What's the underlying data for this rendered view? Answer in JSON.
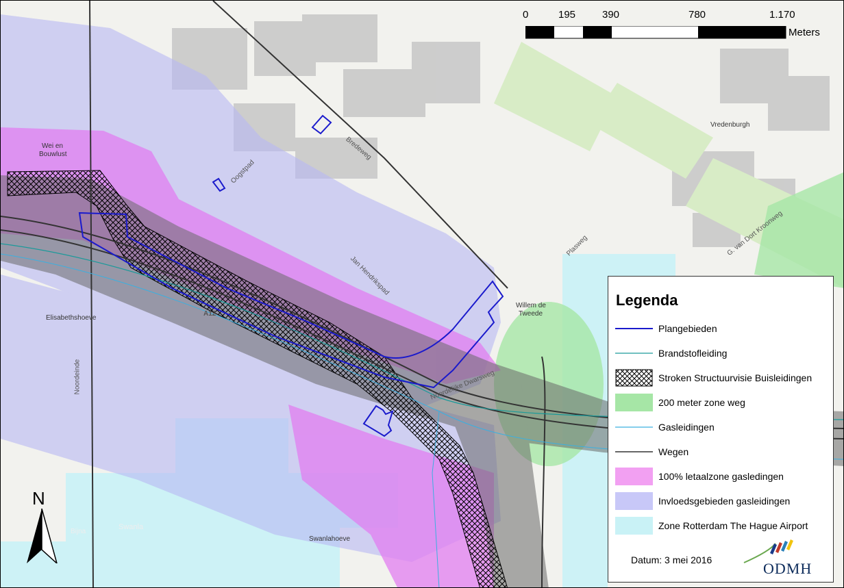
{
  "scale_bar": {
    "ticks": [
      "0",
      "195",
      "390",
      "780",
      "1.170"
    ],
    "units": "Meters"
  },
  "legend": {
    "title": "Legenda",
    "items": [
      {
        "label": "Plangebieden",
        "symbol": "line",
        "color": "#1a1acc"
      },
      {
        "label": "Brandstofleiding",
        "symbol": "line",
        "color": "#1a9a9a"
      },
      {
        "label": "Stroken Structuurvisie Buisleidingen",
        "symbol": "hatch",
        "color": "#000000"
      },
      {
        "label": "200 meter zone weg",
        "symbol": "fill",
        "color": "#a6e6a6"
      },
      {
        "label": "Gasleidingen",
        "symbol": "line",
        "color": "#3ab0e0"
      },
      {
        "label": "Wegen",
        "symbol": "line",
        "color": "#333333"
      },
      {
        "label": "100% letaalzone gasledingen",
        "symbol": "fill",
        "color": "#f2a0f2"
      },
      {
        "label": "Invloedsgebieden gasleidingen",
        "symbol": "fill",
        "color": "#c8c8f8"
      },
      {
        "label": "Zone Rotterdam The Hague Airport",
        "symbol": "fill",
        "color": "#c9f2f6"
      }
    ],
    "date": "Datum: 3 mei 2016",
    "logo_text": "ODMH"
  },
  "north_arrow": "N",
  "map_labels": {
    "wei_en": "Wei en",
    "bouwlust": "Bouwlust",
    "elisabethshoeve": "Elisabethshoeve",
    "vredenburgh": "Vredenburgh",
    "willem_de": "Willem de",
    "tweede": "Tweede",
    "swanla": "Swanla",
    "swanlahoeve": "Swanlahoeve",
    "bijna": "Bijna",
    "bredeweg": "Bredeweg",
    "oogstpad": "Oogstpad",
    "jan_hendrikspad": "Jan Hendrikspad",
    "plasweg": "Plasweg",
    "noordeinde": "Noordeinde",
    "noordelijke_dwarsweg": "Noordelijke Dwarsweg",
    "g_van_dort": "G. van Dort Kroonweg",
    "a12": "A12"
  }
}
